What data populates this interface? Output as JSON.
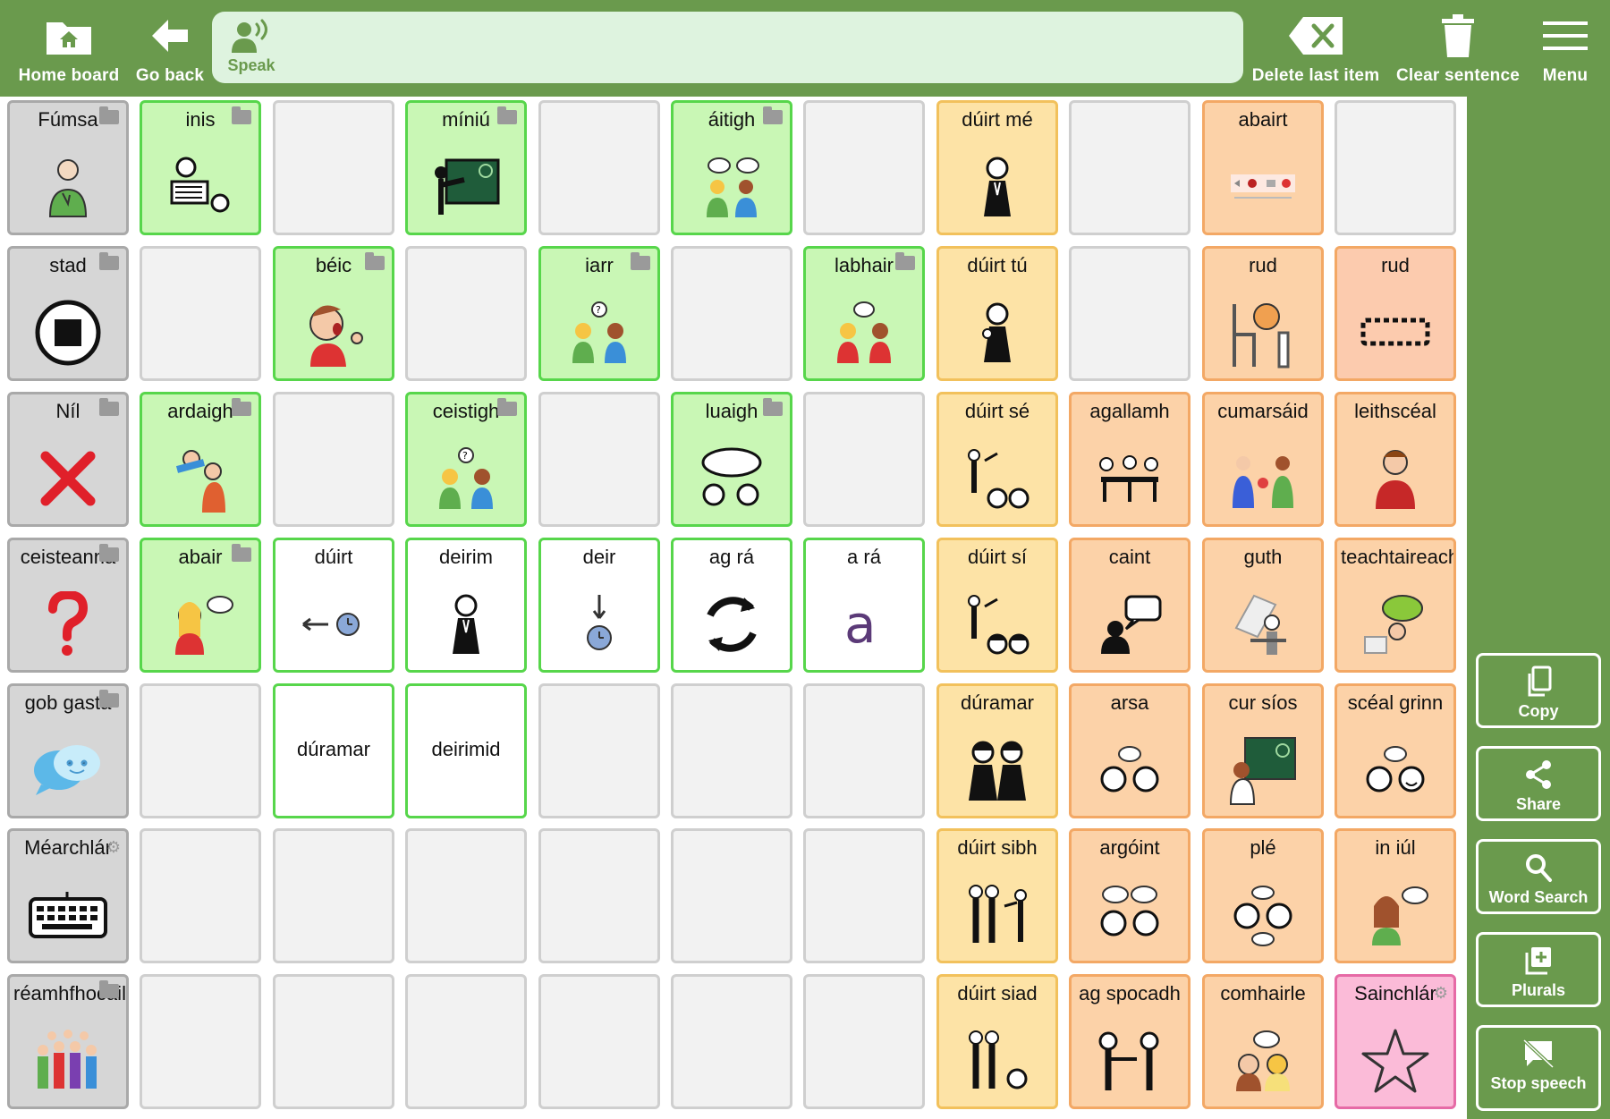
{
  "topbar": {
    "home_label": "Home board",
    "back_label": "Go back",
    "speak_label": "Speak",
    "delete_label": "Delete last item",
    "clear_label": "Clear sentence",
    "menu_label": "Menu"
  },
  "side": {
    "copy": "Copy",
    "share": "Share",
    "word_search": "Word Search",
    "plurals": "Plurals",
    "stop_speech": "Stop speech"
  },
  "colors": {
    "bar_green": "#6a9a4d",
    "sentence_bg": "#def3df",
    "gray_cell": "#d6d6d6",
    "green_cell": "#c9f7b5",
    "yellow_cell": "#fde3a6",
    "orange_cell": "#fcd2a8",
    "pink_cell": "#fbbbd8"
  },
  "rows": [
    [
      {
        "label": "Fúmsa",
        "color": "gray",
        "folder": true,
        "icon": "person-self-icon"
      },
      {
        "label": "inis",
        "color": "green",
        "folder": true,
        "icon": "tell-icon"
      },
      {
        "label": "",
        "color": "empty"
      },
      {
        "label": "míniú",
        "color": "green",
        "folder": true,
        "icon": "blackboard-icon"
      },
      {
        "label": "",
        "color": "empty"
      },
      {
        "label": "áitigh",
        "color": "green",
        "folder": true,
        "icon": "argue-icon"
      },
      {
        "label": "",
        "color": "empty"
      },
      {
        "label": "dúirt mé",
        "color": "yellow",
        "icon": "person-icon"
      },
      {
        "label": "",
        "color": "empty"
      },
      {
        "label": "abairt",
        "color": "orange",
        "icon": "sentence-icon"
      },
      {
        "label": "",
        "color": "empty"
      }
    ],
    [
      {
        "label": "stad",
        "color": "gray",
        "folder": true,
        "icon": "stop-icon"
      },
      {
        "label": "",
        "color": "empty"
      },
      {
        "label": "béic",
        "color": "green",
        "folder": true,
        "icon": "shout-icon"
      },
      {
        "label": "",
        "color": "empty"
      },
      {
        "label": "iarr",
        "color": "green",
        "folder": true,
        "icon": "ask-icon"
      },
      {
        "label": "",
        "color": "empty"
      },
      {
        "label": "labhair",
        "color": "green",
        "folder": true,
        "icon": "talk-icon"
      },
      {
        "label": "dúirt tú",
        "color": "yellow",
        "icon": "person-you-icon"
      },
      {
        "label": "",
        "color": "empty"
      },
      {
        "label": "rud",
        "color": "orange",
        "icon": "things-icon"
      },
      {
        "label": "rud",
        "color": "salmon",
        "icon": "dotted-box-icon"
      }
    ],
    [
      {
        "label": "Níl",
        "color": "gray",
        "folder": true,
        "icon": "red-cross-icon"
      },
      {
        "label": "ardaigh",
        "color": "green",
        "folder": true,
        "icon": "raise-icon"
      },
      {
        "label": "",
        "color": "empty"
      },
      {
        "label": "ceistigh",
        "color": "green",
        "folder": true,
        "icon": "question-people-icon"
      },
      {
        "label": "",
        "color": "empty"
      },
      {
        "label": "luaigh",
        "color": "green",
        "folder": true,
        "icon": "mention-icon"
      },
      {
        "label": "",
        "color": "empty"
      },
      {
        "label": "dúirt sé",
        "color": "yellow",
        "icon": "he-said-icon"
      },
      {
        "label": "agallamh",
        "color": "orange",
        "icon": "interview-icon"
      },
      {
        "label": "cumarsáid",
        "color": "orange",
        "icon": "communication-icon"
      },
      {
        "label": "leithscéal",
        "color": "orange",
        "icon": "apology-icon"
      }
    ],
    [
      {
        "label": "ceisteanna",
        "color": "gray",
        "folder": true,
        "icon": "question-mark-icon"
      },
      {
        "label": "abair",
        "color": "green",
        "folder": true,
        "icon": "say-icon"
      },
      {
        "label": "dúirt",
        "color": "white",
        "icon": "past-arrow-icon"
      },
      {
        "label": "deirim",
        "color": "white",
        "icon": "person-icon"
      },
      {
        "label": "deir",
        "color": "white",
        "icon": "present-arrow-icon"
      },
      {
        "label": "ag rá",
        "color": "white",
        "icon": "cycle-icon"
      },
      {
        "label": "a rá",
        "color": "white",
        "icon": "letter-a-icon"
      },
      {
        "label": "dúirt sí",
        "color": "yellow",
        "icon": "she-said-icon"
      },
      {
        "label": "caint",
        "color": "orange",
        "icon": "speech-bubble-icon"
      },
      {
        "label": "guth",
        "color": "orange",
        "icon": "voice-icon"
      },
      {
        "label": "teachtaireacht",
        "color": "orange",
        "icon": "message-icon"
      }
    ],
    [
      {
        "label": "gob gasta",
        "color": "gray",
        "folder": true,
        "icon": "chat-bubbles-icon"
      },
      {
        "label": "",
        "color": "empty"
      },
      {
        "label": "dúramar",
        "color": "white",
        "mid": true
      },
      {
        "label": "deirimid",
        "color": "white",
        "mid": true
      },
      {
        "label": "",
        "color": "empty"
      },
      {
        "label": "",
        "color": "empty"
      },
      {
        "label": "",
        "color": "empty"
      },
      {
        "label": "dúramar",
        "color": "yellow",
        "icon": "we-said-icon"
      },
      {
        "label": "arsa",
        "color": "orange",
        "icon": "said-heads-icon"
      },
      {
        "label": "cur síos",
        "color": "orange",
        "icon": "describe-icon"
      },
      {
        "label": "scéal grinn",
        "color": "orange",
        "icon": "joke-icon"
      }
    ],
    [
      {
        "label": "Méarchlár",
        "color": "gray",
        "gear": true,
        "icon": "keyboard-icon"
      },
      {
        "label": "",
        "color": "empty"
      },
      {
        "label": "",
        "color": "empty"
      },
      {
        "label": "",
        "color": "empty"
      },
      {
        "label": "",
        "color": "empty"
      },
      {
        "label": "",
        "color": "empty"
      },
      {
        "label": "",
        "color": "empty"
      },
      {
        "label": "dúirt sibh",
        "color": "yellow",
        "icon": "you-plural-icon"
      },
      {
        "label": "argóint",
        "color": "orange",
        "icon": "argument-icon"
      },
      {
        "label": "plé",
        "color": "orange",
        "icon": "discussion-icon"
      },
      {
        "label": "in iúl",
        "color": "orange",
        "icon": "inform-icon"
      }
    ],
    [
      {
        "label": "réamhfhocail",
        "color": "gray",
        "folder": true,
        "icon": "group-people-icon"
      },
      {
        "label": "",
        "color": "empty"
      },
      {
        "label": "",
        "color": "empty"
      },
      {
        "label": "",
        "color": "empty"
      },
      {
        "label": "",
        "color": "empty"
      },
      {
        "label": "",
        "color": "empty"
      },
      {
        "label": "",
        "color": "empty"
      },
      {
        "label": "dúirt siad",
        "color": "yellow",
        "icon": "they-said-icon"
      },
      {
        "label": "ag spocadh",
        "color": "orange",
        "icon": "tease-icon"
      },
      {
        "label": "comhairle",
        "color": "orange",
        "icon": "advice-icon"
      },
      {
        "label": "Sainchlár",
        "color": "pink",
        "gear": true,
        "icon": "star-icon"
      }
    ]
  ]
}
